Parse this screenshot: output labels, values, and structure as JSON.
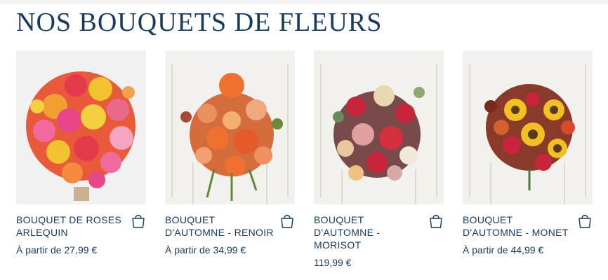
{
  "heading": "NOS BOUQUETS DE FLEURS",
  "products": [
    {
      "name": "BOUQUET DE ROSES ARLEQUIN",
      "price": "À partir de 27,99 €",
      "icon": "shopping-bag-icon"
    },
    {
      "name": "BOUQUET D'AUTOMNE - RENOIR",
      "price": "À partir de 34,99 €",
      "icon": "shopping-bag-icon"
    },
    {
      "name": "BOUQUET D'AUTOMNE - MORISOT",
      "price": "119,99 €",
      "icon": "shopping-bag-icon"
    },
    {
      "name": "BOUQUET D'AUTOMNE - MONET",
      "price": "À partir de 44,99 €",
      "icon": "shopping-bag-icon"
    }
  ],
  "colors": {
    "text": "#173a5e",
    "background": "#ffffff"
  }
}
